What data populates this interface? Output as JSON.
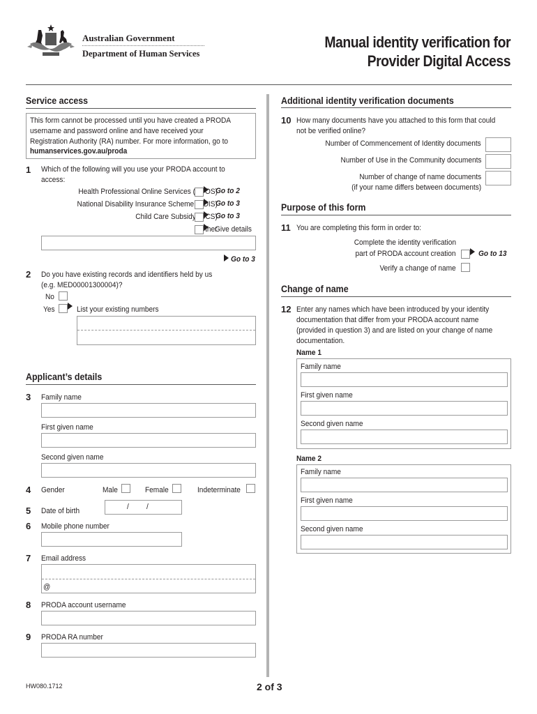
{
  "header": {
    "gov_name": "Australian Government",
    "dept_name": "Department of Human Services",
    "title_line1": "Manual identity verification for",
    "title_line2": "Provider Digital Access",
    "crest_icon": "coat-of-arms-icon"
  },
  "service_access": {
    "heading": "Service access",
    "info_lines": [
      "This form cannot be processed until you have created a PRODA",
      "username and password online and have received your",
      "Registration Authority (RA) number. For more information, go to",
      "humanservices.gov.au/proda"
    ],
    "q1": {
      "num": "1",
      "text_line1": "Which of the following will you use your PRODA account to",
      "text_line2": "access:",
      "options": [
        {
          "label": "Health Professional Online Services (HPOS)",
          "goto": "Go to 2"
        },
        {
          "label": "National Disability Insurance Scheme (NDIS)",
          "goto": "Go to 3"
        },
        {
          "label": "Child Care Subsidy (CCS)",
          "goto": "Go to 3"
        },
        {
          "label": "Other",
          "goto": "Give details"
        }
      ],
      "details_value": "",
      "after_goto": "Go to 3"
    },
    "q2": {
      "num": "2",
      "text_line1": "Do you have existing records and identifiers held by us",
      "text_line2": "(e.g. MED00001300004)?",
      "no_label": "No",
      "yes_label": "Yes",
      "yes_instruction": "List your existing numbers",
      "existing_numbers": [
        "",
        "",
        ""
      ]
    }
  },
  "applicant": {
    "heading": "Applicant’s details",
    "q3": {
      "num": "3",
      "family_label": "Family name",
      "first_label": "First given name",
      "second_label": "Second given name",
      "family_value": "",
      "first_value": "",
      "second_value": ""
    },
    "q4": {
      "num": "4",
      "label": "Gender",
      "male": "Male",
      "female": "Female",
      "indeterminate": "Indeterminate"
    },
    "q5": {
      "num": "5",
      "label": "Date of birth",
      "separator": "/"
    },
    "q6": {
      "num": "6",
      "label": "Mobile phone number",
      "value": ""
    },
    "q7": {
      "num": "7",
      "label": "Email address",
      "at_symbol": "@",
      "value": ""
    },
    "q8": {
      "num": "8",
      "label": "PRODA account username",
      "value": ""
    },
    "q9": {
      "num": "9",
      "label": "PRODA RA number",
      "value": ""
    }
  },
  "additional_docs": {
    "heading": "Additional identity verification documents",
    "q10": {
      "num": "10",
      "text_line1": "How many documents have you attached to this form that could",
      "text_line2": "not be verified online?",
      "coi_label": "Number of Commencement of Identity documents",
      "uic_label": "Number of Use in the Community documents",
      "con_label_line1": "Number of change of name documents",
      "con_label_line2": "(if your name differs between documents)",
      "coi_value": "",
      "uic_value": "",
      "con_value": ""
    }
  },
  "purpose": {
    "heading": "Purpose of this form",
    "q11": {
      "num": "11",
      "text": "You are completing this form in order to:",
      "opt1_line1": "Complete the identity verification",
      "opt1_line2": "part of PRODA account creation",
      "opt1_goto": "Go to 13",
      "opt2": "Verify a change of name"
    }
  },
  "change_of_name": {
    "heading": "Change of name",
    "q12": {
      "num": "12",
      "lines": [
        "Enter any names which have been introduced by your identity",
        "documentation that differ from your PRODA account name",
        "(provided in question 3) and are listed on your change of name",
        "documentation."
      ],
      "names": [
        {
          "title": "Name 1",
          "family_label": "Family name",
          "first_label": "First given name",
          "second_label": "Second given name"
        },
        {
          "title": "Name 2",
          "family_label": "Family name",
          "first_label": "First given name",
          "second_label": "Second given name"
        }
      ]
    }
  },
  "footer": {
    "form_code": "HW080.1712",
    "page": "2 of 3"
  }
}
